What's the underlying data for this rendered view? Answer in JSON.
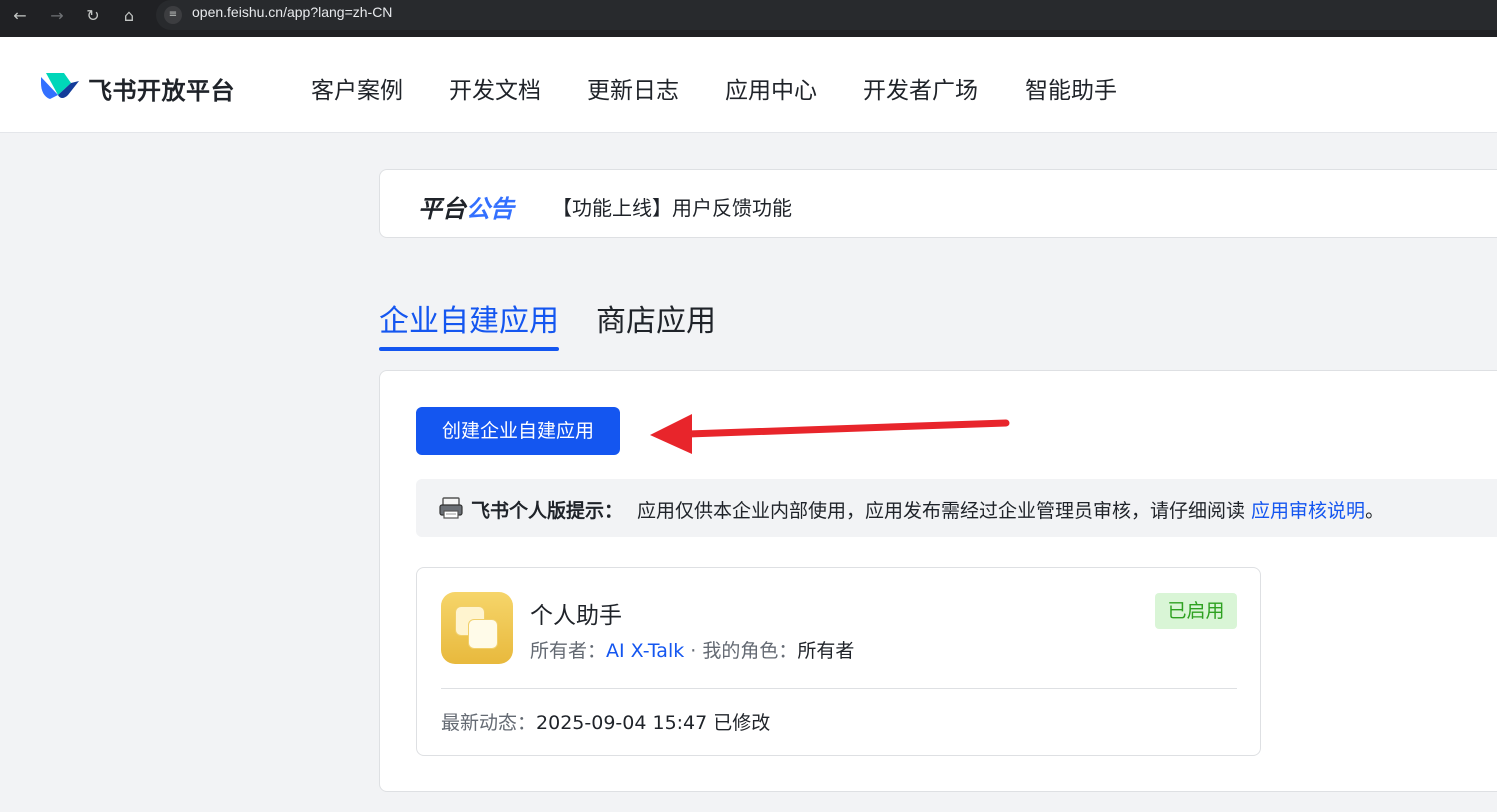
{
  "browser": {
    "url": "open.feishu.cn/app?lang=zh-CN",
    "back_icon": "arrow-left-icon",
    "forward_icon": "arrow-right-icon",
    "reload_icon": "reload-icon",
    "home_icon": "home-icon"
  },
  "header": {
    "brand": "飞书开放平台",
    "nav": [
      "客户案例",
      "开发文档",
      "更新日志",
      "应用中心",
      "开发者广场",
      "智能助手"
    ]
  },
  "announcement": {
    "title_part1": "平台",
    "title_part2": "公告",
    "text": "【功能上线】用户反馈功能"
  },
  "tabs": {
    "active": "企业自建应用",
    "inactive": "商店应用"
  },
  "panel": {
    "create_button": "创建企业自建应用",
    "notice": {
      "bold": "飞书个人版提示：",
      "text": "应用仅供本企业内部使用，应用发布需经过企业管理员审核，请仔细阅读 ",
      "link": "应用审核说明",
      "end": "。"
    },
    "app": {
      "name": "个人助手",
      "owner_label": "所有者：",
      "owner": "AI X-Talk",
      "separator": " · ",
      "role_label": "我的角色：",
      "role": "所有者",
      "status": "已启用",
      "activity_label": "最新动态：",
      "activity": "2025-09-04 15:47 已修改"
    }
  },
  "colors": {
    "accent": "#1456f0",
    "status_green": "#2ea121",
    "annotation_red": "#e8252b"
  }
}
